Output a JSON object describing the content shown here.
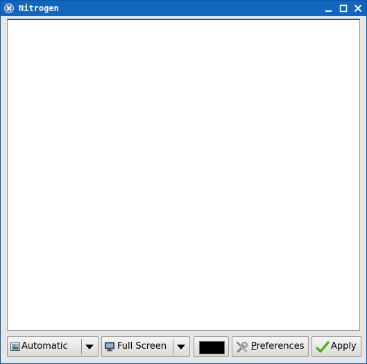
{
  "window": {
    "title": "Nitrogen",
    "controls": {
      "minimize": "minimize",
      "maximize": "maximize",
      "close": "close"
    }
  },
  "toolbar": {
    "mode_combo": {
      "value": "Automatic",
      "icon": "image-icon"
    },
    "display_combo": {
      "value": "Full Screen",
      "icon": "monitor-icon"
    },
    "bg_color": {
      "color": "#000000"
    },
    "preferences": {
      "label_prefix": "",
      "mnemonic": "P",
      "label_rest": "references",
      "icon": "tools-icon"
    },
    "apply": {
      "label": "Apply",
      "icon": "checkmark-icon"
    }
  },
  "colors": {
    "titlebar": "#1266be",
    "accent_check": "#3fae1c"
  }
}
